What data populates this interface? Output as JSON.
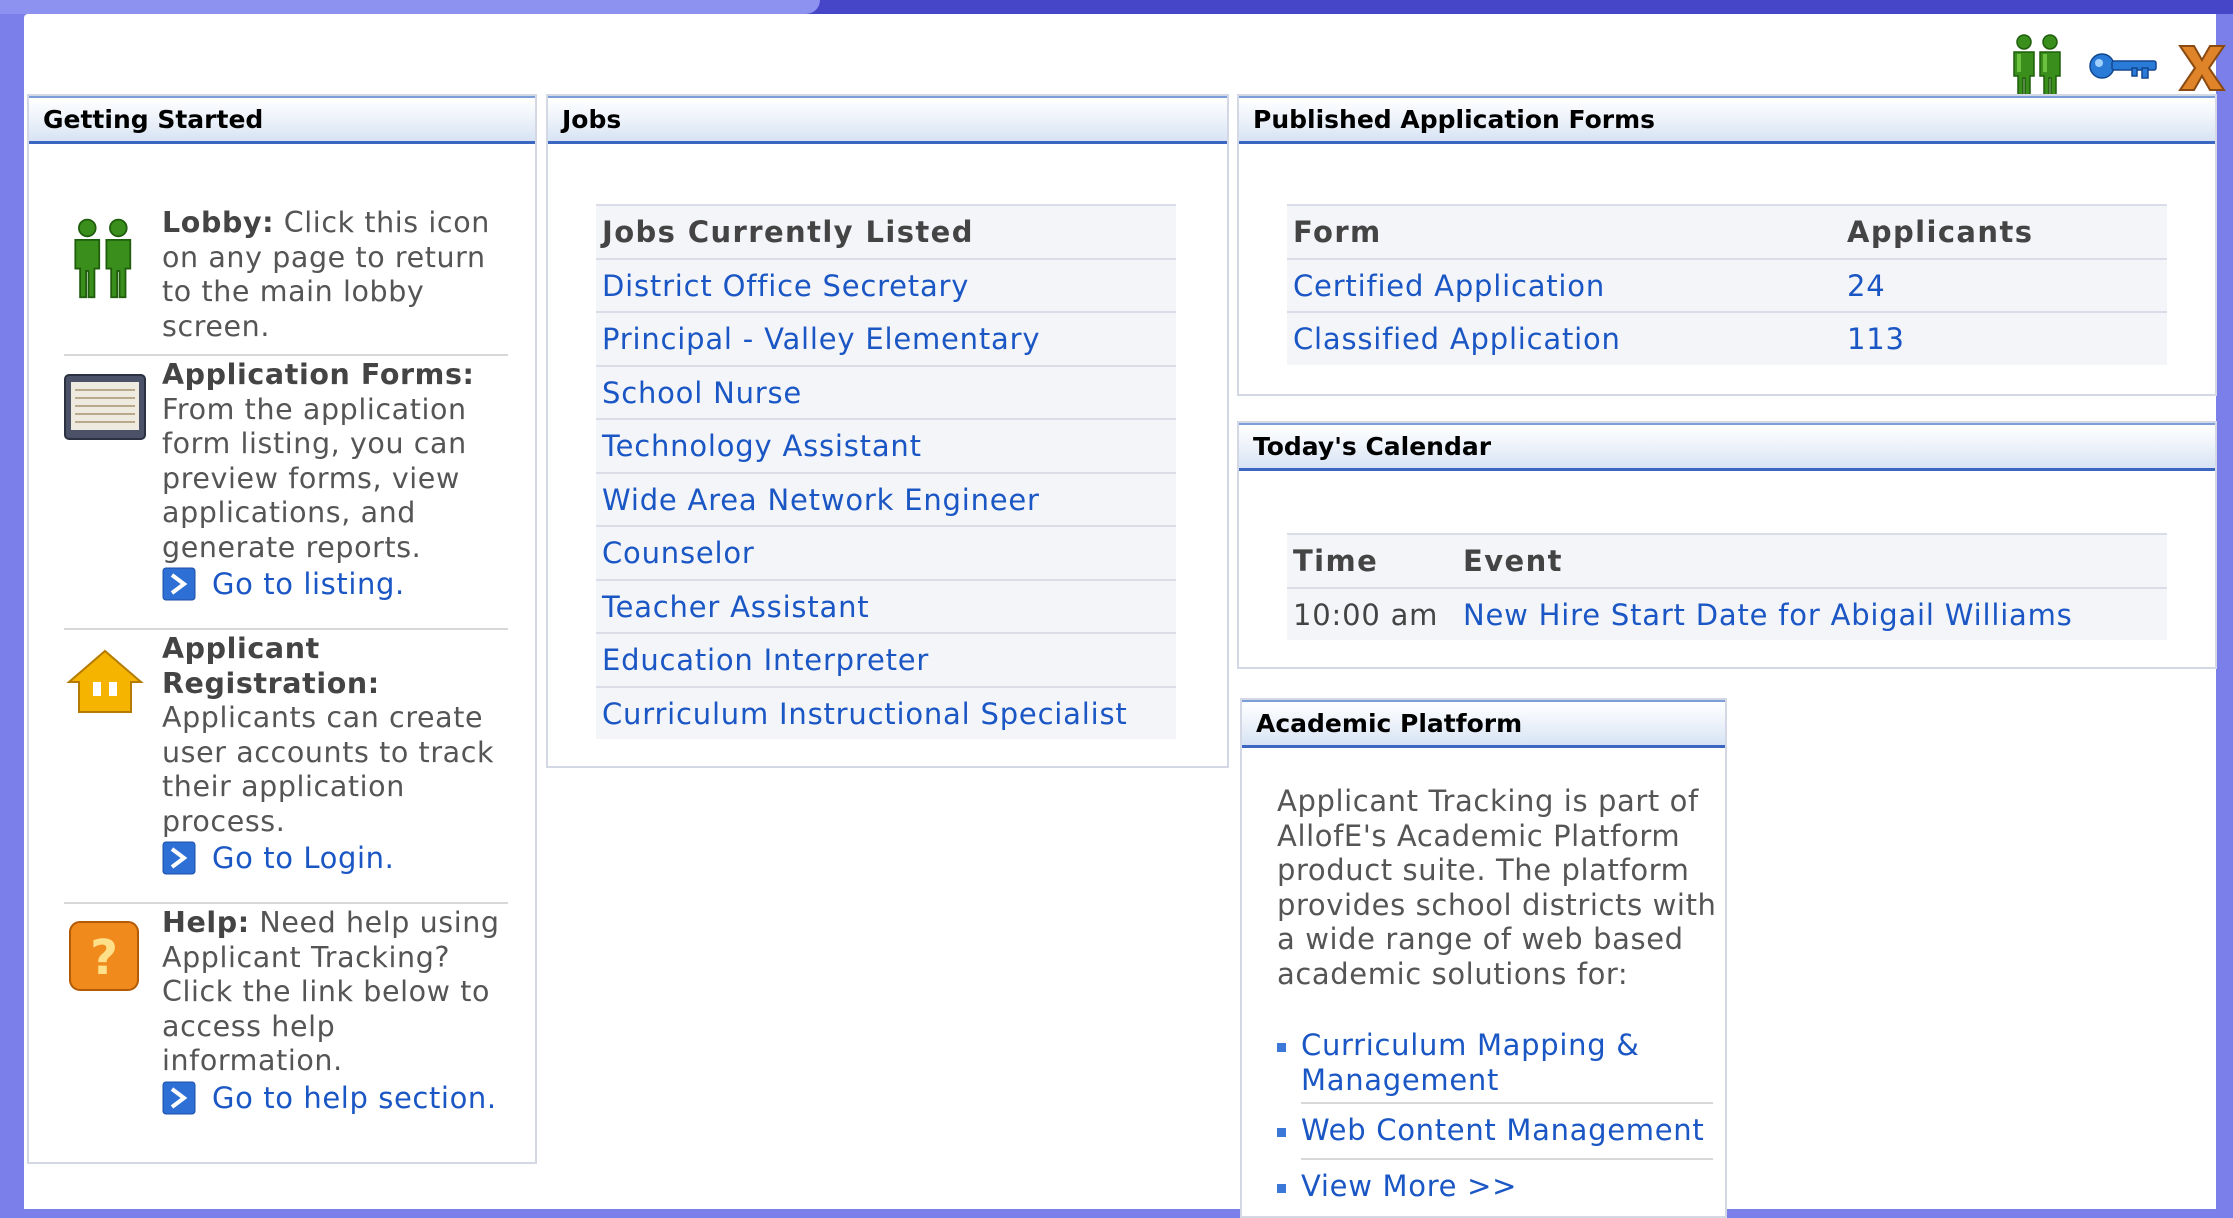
{
  "header": {
    "lobby_icon": "lobby-people-icon",
    "key_icon": "key-icon",
    "close_icon": "close-x-icon"
  },
  "getting_started": {
    "title": "Getting Started",
    "items": [
      {
        "icon": "lobby-people-icon",
        "heading": "Lobby:",
        "text": " Click this icon on any page to return to the main lobby screen."
      },
      {
        "icon": "application-forms-icon",
        "heading": "Application Forms:",
        "text": " From the application form listing, you can preview forms, view applications, and generate reports.",
        "link": "Go to listing."
      },
      {
        "icon": "house-icon",
        "heading": "Applicant Registration:",
        "text": " Applicants can create user accounts to track their application process.",
        "link": "Go to Login."
      },
      {
        "icon": "help-question-icon",
        "heading": "Help:",
        "text": " Need help using Applicant Tracking? Click the link below to access help information.",
        "link": "Go to help section."
      }
    ]
  },
  "jobs": {
    "title": "Jobs",
    "header": "Jobs Currently Listed",
    "items": [
      "District Office Secretary",
      "Principal - Valley Elementary",
      "School Nurse",
      "Technology Assistant",
      "Wide Area Network Engineer",
      "Counselor",
      "Teacher Assistant",
      "Education Interpreter",
      "Curriculum Instructional Specialist"
    ]
  },
  "forms": {
    "title": "Published Application Forms",
    "columns": [
      "Form",
      "Applicants"
    ],
    "rows": [
      [
        "Certified Application",
        "24"
      ],
      [
        "Classified Application",
        "113"
      ]
    ]
  },
  "calendar": {
    "title": "Today's Calendar",
    "columns": [
      "Time",
      "Event"
    ],
    "rows": [
      [
        "10:00 am",
        "New Hire Start Date for Abigail Williams"
      ]
    ]
  },
  "academic": {
    "title": "Academic Platform",
    "intro": "Applicant Tracking is part of AllofE's Academic Platform product suite. The platform provides school districts with a wide range of web based academic solutions for:",
    "links": [
      "Curriculum Mapping & Management",
      "Web Content Management",
      "View More >>"
    ]
  },
  "colors": {
    "background": "#7b7fe9",
    "header_border": "#3b67c2",
    "link": "#1a56c4"
  }
}
